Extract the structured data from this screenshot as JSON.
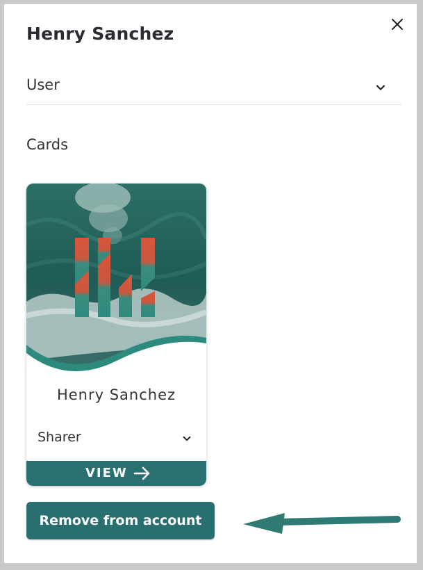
{
  "dialog": {
    "title": "Henry Sanchez",
    "close_icon": "close-icon"
  },
  "role_select": {
    "value": "User",
    "icon": "chevron-down-icon"
  },
  "cards_section": {
    "label": "Cards"
  },
  "card": {
    "name": "Henry Sanchez",
    "permission_select": {
      "value": "Sharer",
      "icon": "chevron-down-icon"
    },
    "view_button": {
      "label": "VIEW",
      "icon": "arrow-right-icon"
    }
  },
  "remove_button": {
    "label": "Remove from account"
  },
  "colors": {
    "accent": "#2a6f6f",
    "logo_orange": "#d9573a",
    "logo_teal": "#2f8a7e"
  }
}
